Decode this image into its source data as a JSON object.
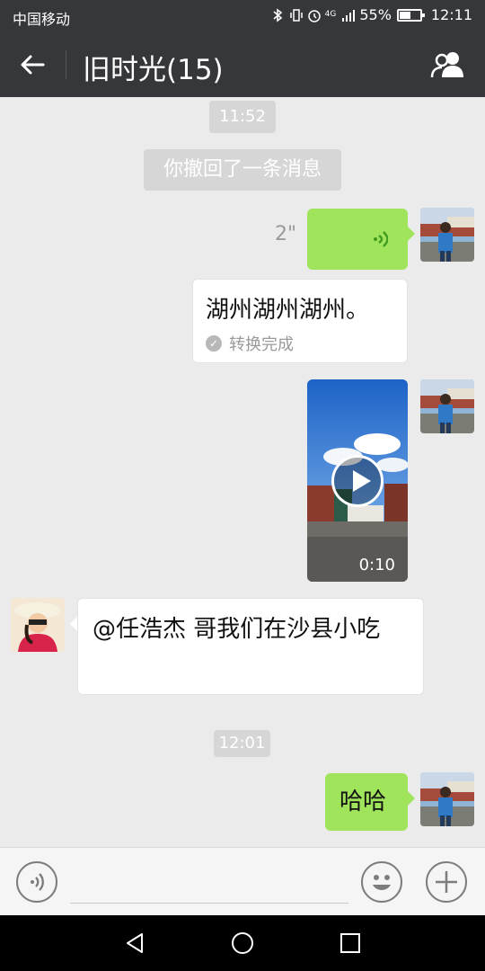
{
  "status_bar": {
    "carrier": "中国移动",
    "network": "4G",
    "battery": "55%",
    "battery_level": 0.55,
    "time": "12:11",
    "icons": [
      "bluetooth-icon",
      "vibrate-icon",
      "alarm-icon",
      "signal-icon",
      "battery-icon"
    ]
  },
  "header": {
    "title": "旧时光(15)",
    "back_icon": "arrow-left-icon",
    "group_icon": "group-members-icon"
  },
  "messages": {
    "time1": "11:52",
    "system": "你撤回了一条消息",
    "voice_duration": "2\"",
    "transcript_text": "湖州湖州湖州。",
    "transcript_status": "转换完成",
    "video_duration": "0:10",
    "incoming_text": "@任浩杰  哥我们在沙县小吃",
    "time2": "12:01",
    "outgoing_text": "哈哈"
  },
  "input_bar": {
    "voice_icon": "voice-toggle-icon",
    "emoji_icon": "emoji-icon",
    "plus_icon": "plus-icon",
    "placeholder": ""
  },
  "nav_bar": {
    "icons": [
      "nav-back-icon",
      "nav-home-icon",
      "nav-recent-icon"
    ]
  },
  "colors": {
    "header_bg": "#36373b",
    "chat_bg": "#ebebeb",
    "bubble_green": "#9fe45a",
    "bubble_white": "#ffffff",
    "time_badge": "#d6d6d6"
  }
}
